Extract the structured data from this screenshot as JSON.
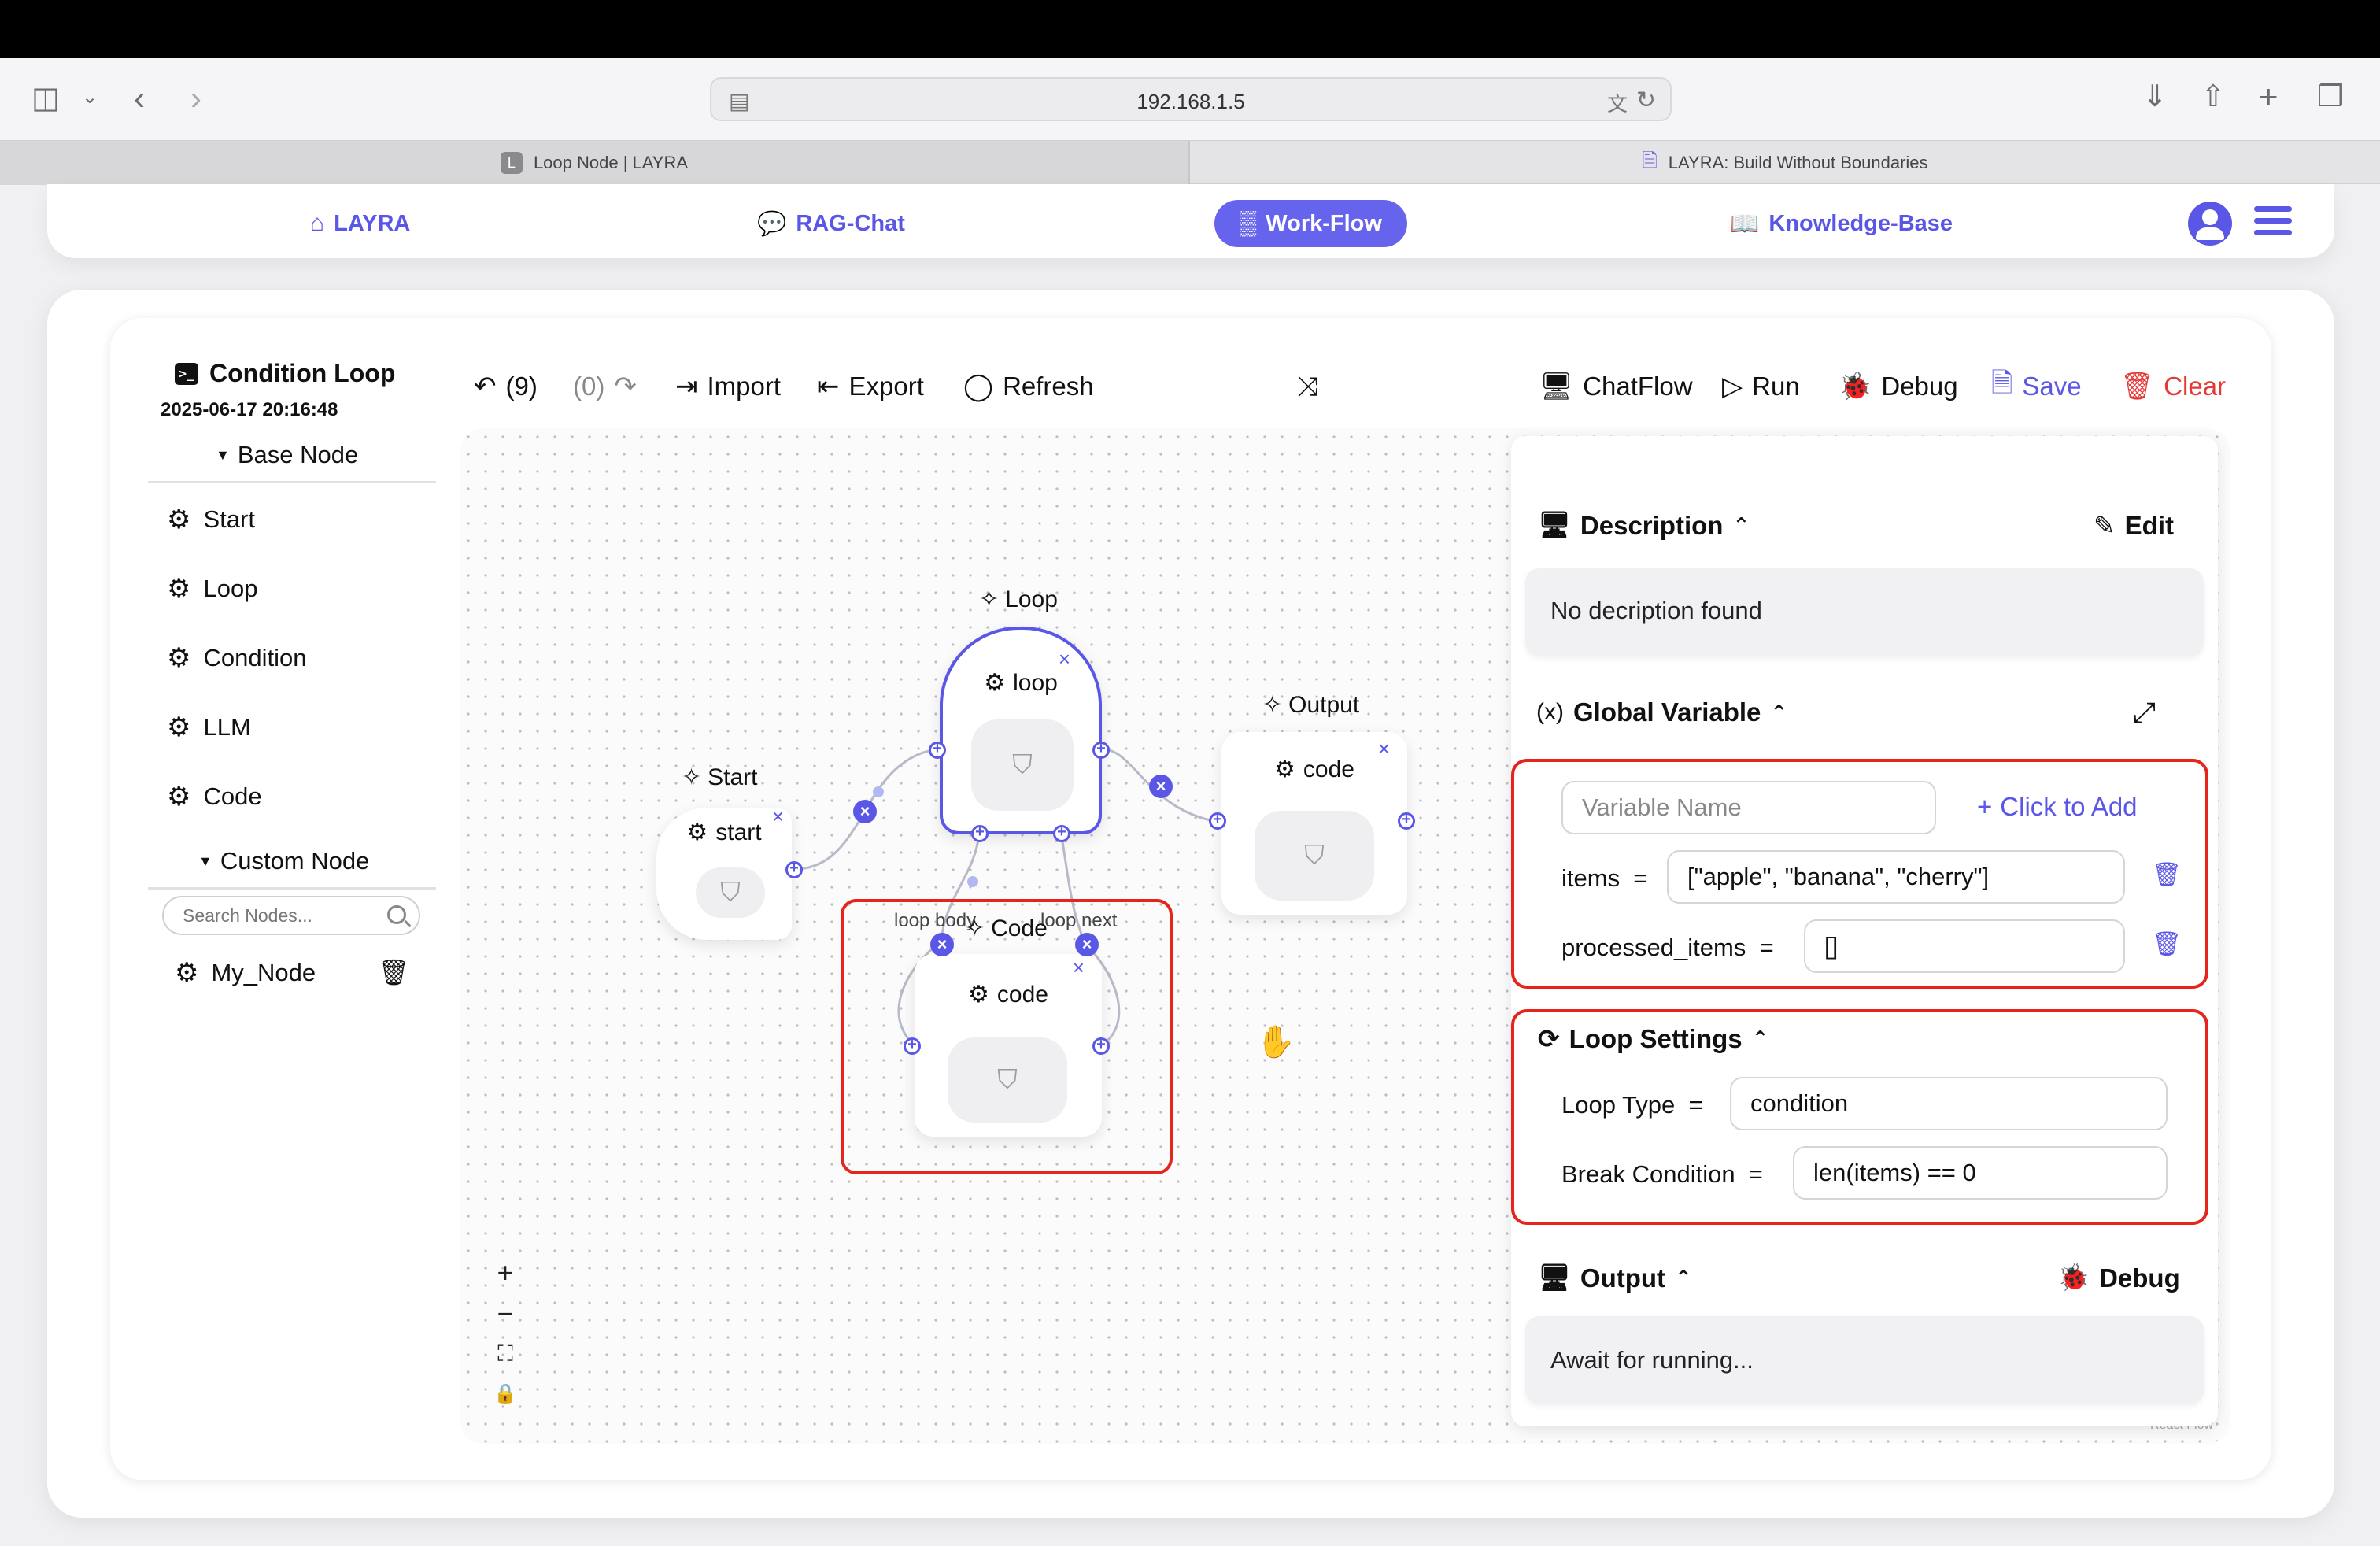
{
  "browser": {
    "url": "192.168.1.5",
    "tabs": [
      {
        "label": "Loop Node | LAYRA",
        "favicon": "L"
      },
      {
        "label": "LAYRA: Build Without Boundaries"
      }
    ]
  },
  "nav": {
    "items": [
      {
        "label": "LAYRA",
        "icon": "home-icon"
      },
      {
        "label": "RAG-Chat",
        "icon": "chat-icon"
      },
      {
        "label": "Work-Flow",
        "icon": "terminal-icon",
        "active": true
      },
      {
        "label": "Knowledge-Base",
        "icon": "book-icon"
      }
    ],
    "accent": "#5b57e6"
  },
  "workflow": {
    "title": "Condition Loop",
    "date": "2025-06-17 20:16:48"
  },
  "sidebar": {
    "base_head": "Base Node",
    "base_nodes": [
      "Start",
      "Loop",
      "Condition",
      "LLM",
      "Code"
    ],
    "custom_head": "Custom Node",
    "search_placeholder": "Search Nodes...",
    "custom_nodes": [
      "My_Node"
    ]
  },
  "toolbar": {
    "undo": "(9)",
    "redo": "(0)",
    "import": "Import",
    "export": "Export",
    "refresh": "Refresh",
    "chatflow": "ChatFlow",
    "run": "Run",
    "debug": "Debug",
    "save": "Save",
    "clear": "Clear"
  },
  "canvas": {
    "nodes": {
      "start": {
        "label": "Start",
        "name": "start"
      },
      "loop": {
        "label": "Loop",
        "name": "loop"
      },
      "output": {
        "label": "Output",
        "name": "code"
      },
      "code": {
        "label": "Code",
        "name": "code"
      }
    },
    "edge_labels": {
      "loop_body": "loop body",
      "loop_next": "loop next"
    },
    "controls": [
      "+",
      "−",
      "⛶",
      "🔒"
    ]
  },
  "panel": {
    "description_head": "Description",
    "edit": "Edit",
    "description_text": "No decription found",
    "global_var_head": "Global Variable",
    "var_placeholder": "Variable Name",
    "click_to_add": "Click to Add",
    "variables": [
      {
        "name": "items",
        "value": "[\"apple\", \"banana\", \"cherry\"]"
      },
      {
        "name": "processed_items",
        "value": "[]"
      }
    ],
    "loop_settings_head": "Loop Settings",
    "loop_type_label": "Loop Type",
    "loop_type_value": "condition",
    "break_label": "Break Condition",
    "break_value": "len(items) == 0",
    "output_head": "Output",
    "debug": "Debug",
    "output_text": "Await for running..."
  }
}
